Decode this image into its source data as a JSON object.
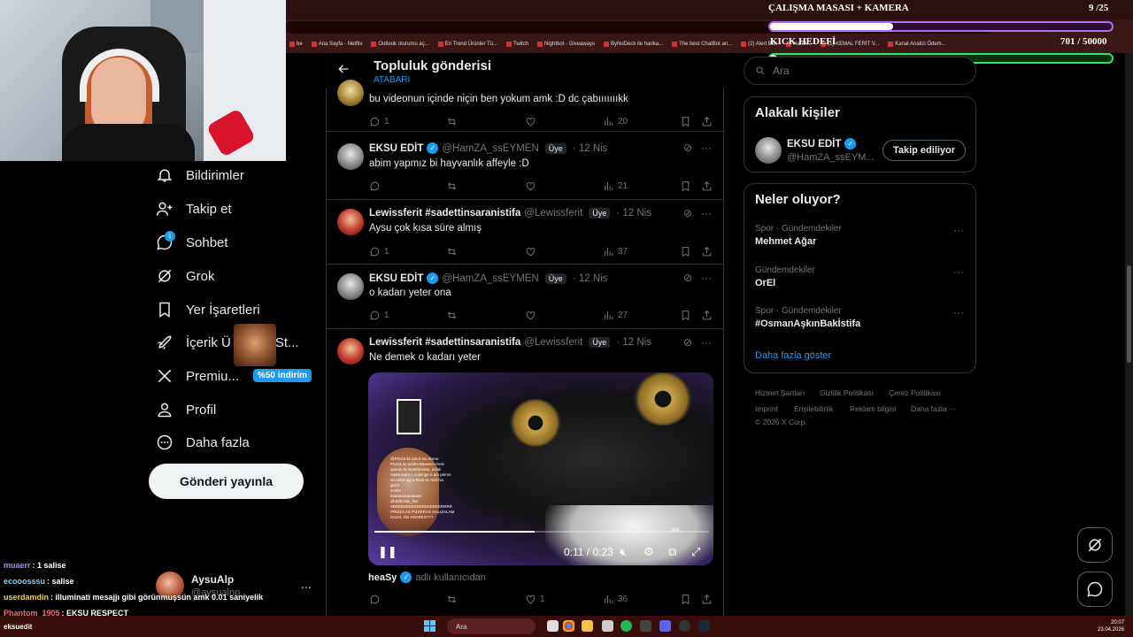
{
  "overlay": {
    "goal_title": "ÇALIŞMA MASASI + KAMERA",
    "goal_count": "9 /25",
    "goal_progress": 0.36,
    "kick_title": "KICK HEDEFİ",
    "kick_count": "701 / 50000",
    "kick_progress": 0.014
  },
  "bookmarks": [
    "be",
    "Ana Sayfa - Netflix",
    "Outlook oturumu aç...",
    "En Trend Ürünler Tü...",
    "Twitch",
    "Nightbot - Giveaways",
    "ByNoDeck ile harika...",
    "The best ChatBot an...",
    "(2) Alert Box",
    "Harek...",
    "(1) KEMAL FERİT V...",
    "Kanal Analizi Ödem..."
  ],
  "nav": {
    "items": [
      {
        "label": "Bildirimler",
        "icon": "bell-icon"
      },
      {
        "label": "Takip et",
        "icon": "person-plus-icon"
      },
      {
        "label": "Sohbet",
        "icon": "chat-icon"
      },
      {
        "label": "Grok",
        "icon": "grok-icon"
      },
      {
        "label": "Yer İşaretleri",
        "icon": "bookmark-icon"
      },
      {
        "label": "İçerik Ü",
        "label_tail": "St...",
        "icon": "rocket-icon"
      },
      {
        "label": "Premiu...",
        "icon": "x-logo-icon"
      },
      {
        "label": "Profil",
        "icon": "person-icon"
      },
      {
        "label": "Daha fazla",
        "icon": "more-circle-icon"
      }
    ],
    "chat_badge": "1",
    "promo_badge": "%50 indirim",
    "post_button": "Gönderi yayınla"
  },
  "account": {
    "name": "AysuAlp",
    "handle": "@aysualpp",
    "more": "..."
  },
  "chat": [
    {
      "user": "muaerr",
      "color": "#b084ff",
      "text": ": 1 salise"
    },
    {
      "user": "ecooosssu",
      "color": "#7fd3ff",
      "text": ": salise"
    },
    {
      "user": "userdamdin",
      "color": "#ffcc33",
      "text": ": illuminati mesajjı gibi görünmuşsün amk 0.01 saniyelik"
    },
    {
      "user": "Phantom_1905",
      "color": "#ff6b6b",
      "text": ": EKSU RESPECT"
    }
  ],
  "header": {
    "title": "Topluluk gönderisi",
    "subtitle": "ATABARI",
    "back_icon": "arrow-left-icon"
  },
  "tweets": [
    {
      "text": "bu videonun içinde niçin ben yokum amk :D dc çabıııııııkk",
      "replies": "1",
      "likes": "",
      "views": "20"
    },
    {
      "name": "EKSU EDİT",
      "verified": true,
      "handle": "@HamZA_ssEYMEN",
      "tag": "Üye",
      "date": "· 12 Nis",
      "text": "abim yapmız bi hayvanlık affeyle :D",
      "replies": "",
      "likes": "",
      "views": "21"
    },
    {
      "name": "Lewissferit #sadettinsaranistifa",
      "verified": false,
      "handle": "@Lewissferit",
      "tag": "Üye",
      "date": "· 12 Nis",
      "text": "Aysu çok kısa süre almış",
      "replies": "1",
      "likes": "",
      "views": "37"
    },
    {
      "name": "EKSU EDİT",
      "verified": true,
      "handle": "@HamZA_ssEYMEN",
      "tag": "Üye",
      "date": "· 12 Nis",
      "text": "o kadarı yeter ona",
      "replies": "1",
      "likes": "",
      "views": "27"
    },
    {
      "name": "Lewissferit #sadettinsaranistifa",
      "verified": false,
      "handle": "@Lewissferit",
      "tag": "Üye",
      "date": "· 12 Nis",
      "text": "Ne demek o kadarı yeter",
      "replies": "",
      "likes": "1",
      "views": "36"
    }
  ],
  "video": {
    "time": "0:11 / 0:23",
    "progress": 0.48,
    "overlay_text": "@Prizza ile pra ti tou dorou\nPrizza ey anirini Bawesn chrec\nqusolo ta mesrhendas, adlali\nnosta leam o cuininge e am peiros\ndo mere ugi a Rout ez mal nia\ngsrol\nKANA\nkaaaaaaaaaaaaa\n@stdbrvski_fan\nVEEEEEEEEEEEEEEEEEERRRR\nPRIZZA AS PIZZERAS DALIZALAM\nIGUAL OS ANDRES???",
    "tiktok": "WA...",
    "attribution_name": "heaSy",
    "attribution_desc": "adlı kullanıcıdan"
  },
  "right": {
    "search_placeholder": "Ara",
    "people_title": "Alakalı kişiler",
    "person": {
      "name": "EKSU EDİT",
      "handle": "@HamZA_ssEYM...",
      "button": "Takip ediliyor"
    },
    "trends_title": "Neler oluyor?",
    "trends": [
      {
        "category": "Spor · Gündemdekiler",
        "name": "Mehmet Ağar"
      },
      {
        "category": "Gündemdekiler",
        "name": "OrEl"
      },
      {
        "category": "Spor · Gündemdekiler",
        "name": "#OsmanAşkınBakİstifa"
      }
    ],
    "show_more": "Daha fazla göster",
    "footer": [
      "Hizmet Şartları",
      "Gizlilik Politikası",
      "Çerez Politikası",
      "Imprint",
      "Erişilebilirlik",
      "Reklam bilgisi",
      "Daha fazla ···",
      "© 2026 X Corp."
    ]
  },
  "taskbar": {
    "search": "Ara",
    "time": "20:07",
    "date": "23.04.2026",
    "stream_tag": "eksuedit"
  },
  "colors": {
    "accent": "#1d9bf0",
    "text": "#e7e9ea",
    "muted": "#71767b",
    "border": "#2f3336"
  }
}
